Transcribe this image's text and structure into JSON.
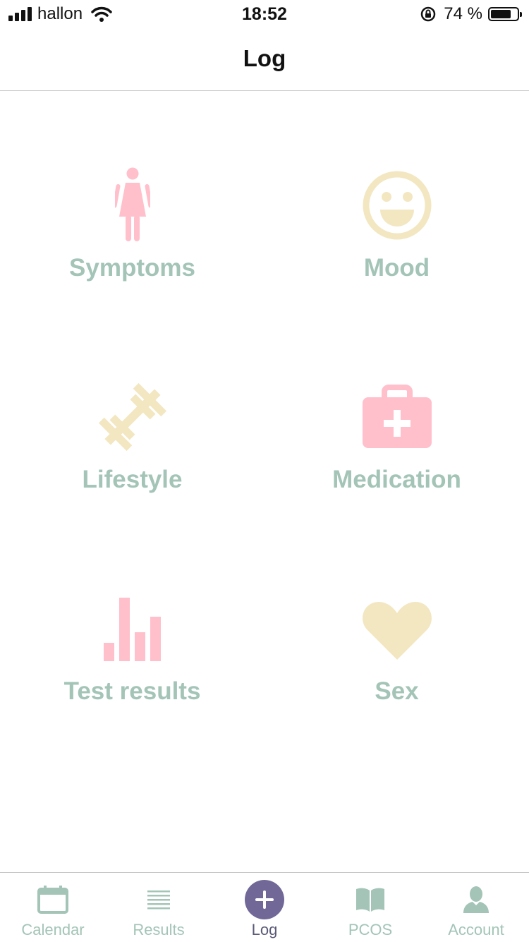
{
  "status_bar": {
    "carrier": "hallon",
    "time": "18:52",
    "battery_percent": "74 %",
    "battery_level": 0.74
  },
  "nav": {
    "title": "Log"
  },
  "categories": [
    {
      "label": "Symptoms",
      "icon": "woman-icon",
      "color": "#ffc0cb"
    },
    {
      "label": "Mood",
      "icon": "smiley-icon",
      "color": "#f3e7c2"
    },
    {
      "label": "Lifestyle",
      "icon": "dumbbell-icon",
      "color": "#f3e7c2"
    },
    {
      "label": "Medication",
      "icon": "first-aid-kit-icon",
      "color": "#ffc0cb"
    },
    {
      "label": "Test results",
      "icon": "bar-chart-icon",
      "color": "#ffc0cb"
    },
    {
      "label": "Sex",
      "icon": "heart-icon",
      "color": "#f3e7c2"
    }
  ],
  "tabs": [
    {
      "label": "Calendar",
      "icon": "calendar-icon"
    },
    {
      "label": "Results",
      "icon": "list-icon"
    },
    {
      "label": "Log",
      "icon": "plus-icon",
      "active": true
    },
    {
      "label": "PCOS",
      "icon": "book-icon"
    },
    {
      "label": "Account",
      "icon": "person-icon"
    }
  ],
  "colors": {
    "label_green": "#a3c4b7",
    "pink": "#ffc0cb",
    "cream": "#f3e7c2",
    "tab_active_bg": "#716898"
  }
}
